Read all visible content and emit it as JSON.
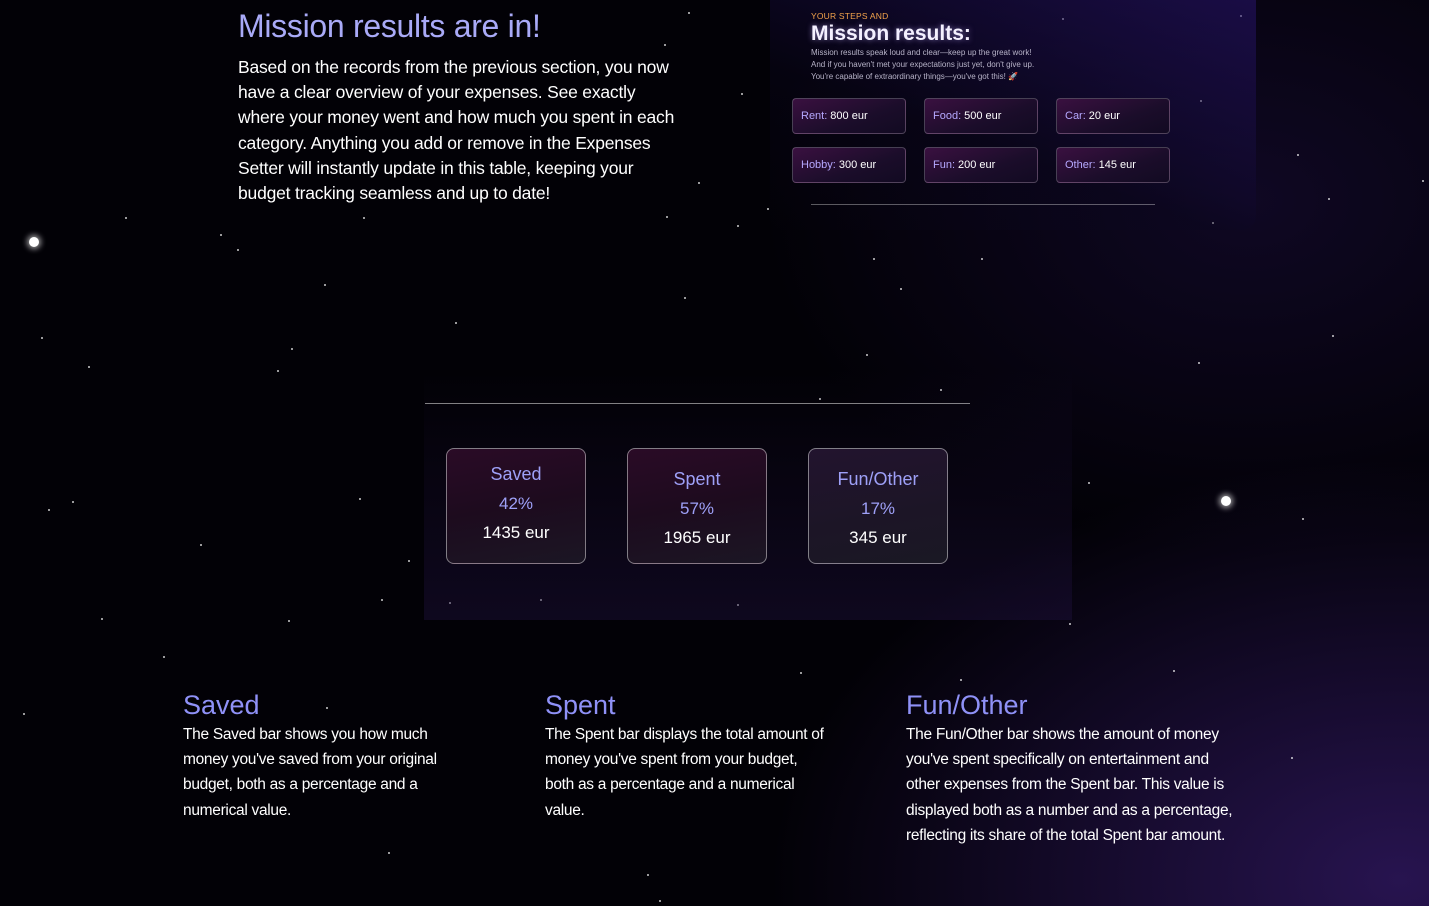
{
  "intro": {
    "title": "Mission results are in!",
    "body": "Based on the records from the previous section, you now have a clear overview of your expenses. See exactly where your money went and how much you spent in each category. Anything you add or remove in the Expenses Setter will instantly update in this table, keeping your budget tracking seamless and up to date!"
  },
  "preview": {
    "eyebrow": "YOUR STEPS AND",
    "title": "Mission results:",
    "line1": "Mission results speak loud and clear—keep up the great work!",
    "line2": "And if you haven't met your expectations just yet, don't give up.",
    "line3": "You're capable of extraordinary things—you've got this! 🚀",
    "chips": [
      {
        "key": "Rent:",
        "value": "800 eur"
      },
      {
        "key": "Food:",
        "value": "500 eur"
      },
      {
        "key": "Car:",
        "value": "20 eur"
      },
      {
        "key": "Hobby:",
        "value": "300 eur"
      },
      {
        "key": "Fun:",
        "value": "200 eur"
      },
      {
        "key": "Other:",
        "value": "145 eur"
      }
    ]
  },
  "stats": [
    {
      "title": "Saved",
      "percent": "42%",
      "amount": "1435 eur"
    },
    {
      "title": "Spent",
      "percent": "57%",
      "amount": "1965 eur"
    },
    {
      "title": "Fun/Other",
      "percent": "17%",
      "amount": "345 eur"
    }
  ],
  "explanations": [
    {
      "title": "Saved",
      "text": "The Saved bar shows you how much money you've saved from your original budget, both as a percentage and a numerical value."
    },
    {
      "title": "Spent",
      "text": "The Spent bar displays the total amount of money you've spent from your budget, both as a percentage and a numerical value."
    },
    {
      "title": "Fun/Other",
      "text": "The Fun/Other bar shows the amount of money you've spent specifically on entertainment and other expenses from the Spent bar. This value is displayed both as a number and as a percentage, reflecting its share of the total Spent bar amount."
    }
  ]
}
